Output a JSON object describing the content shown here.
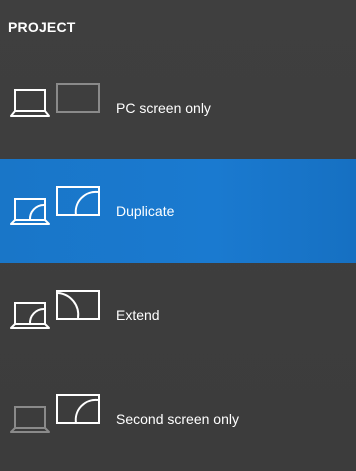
{
  "panel": {
    "title": "PROJECT"
  },
  "options": [
    {
      "label": "PC screen only",
      "icon": "pc-screen-only-icon",
      "selected": false
    },
    {
      "label": "Duplicate",
      "icon": "duplicate-icon",
      "selected": true
    },
    {
      "label": "Extend",
      "icon": "extend-icon",
      "selected": false
    },
    {
      "label": "Second screen only",
      "icon": "second-screen-only-icon",
      "selected": false
    }
  ],
  "colors": {
    "background": "#3d3d3d",
    "selected": "#1a78cc",
    "icon_active": "#ffffff",
    "icon_dim": "#8a8a8a"
  }
}
